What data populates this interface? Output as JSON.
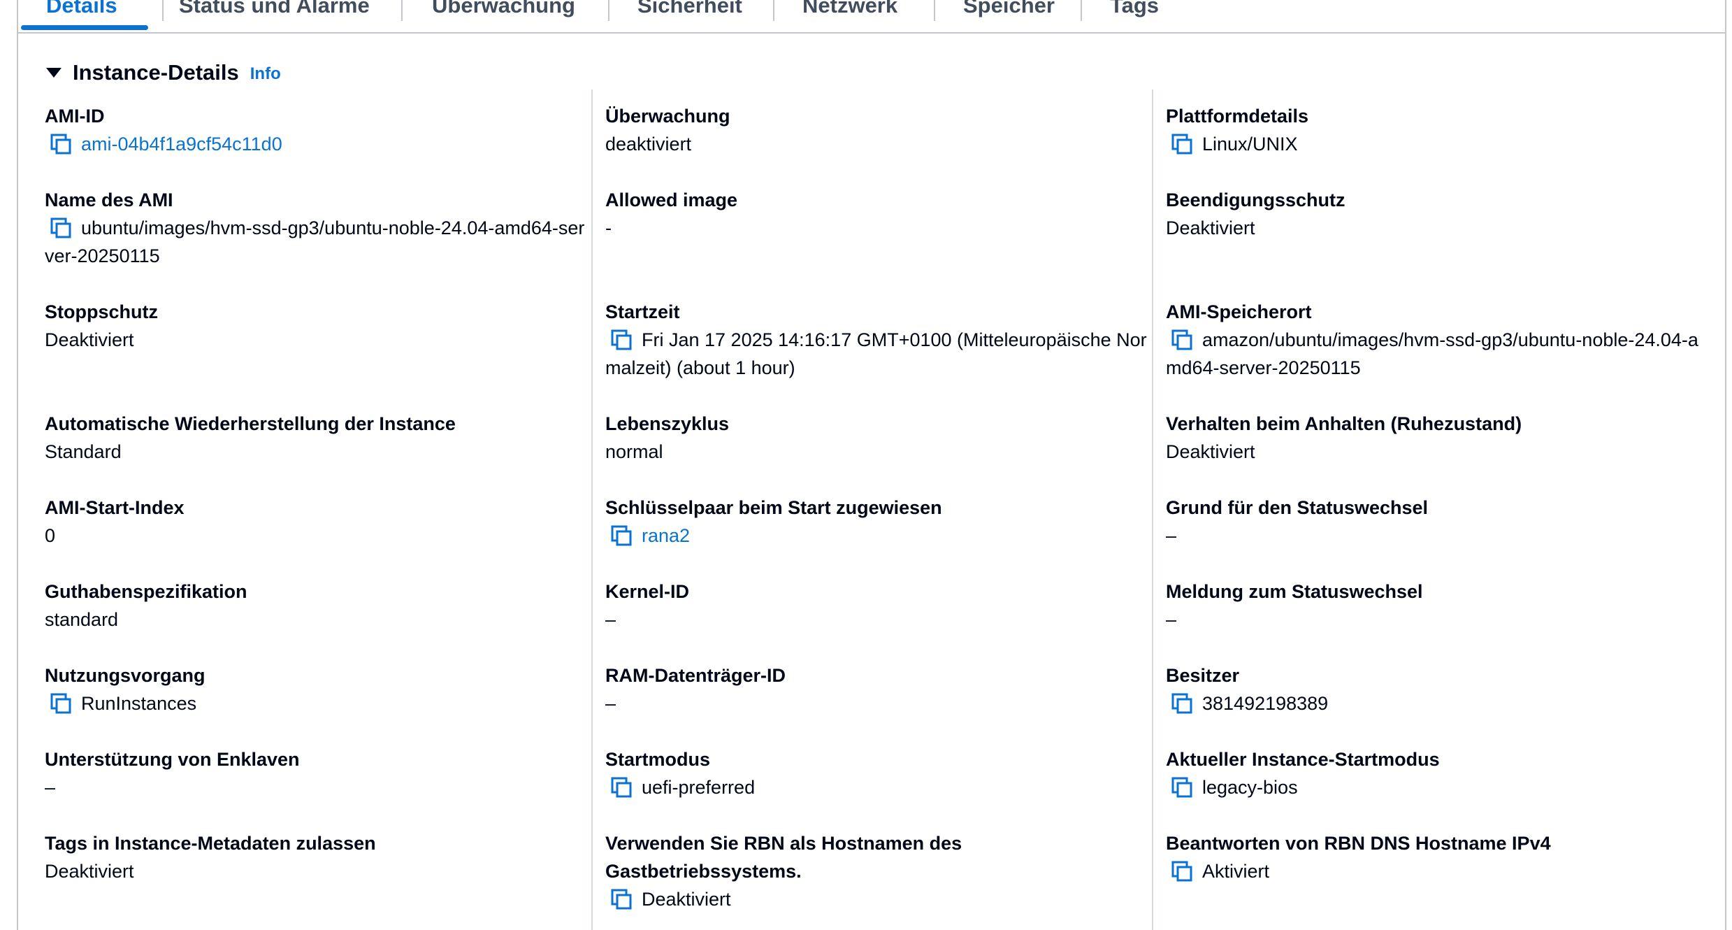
{
  "tabs": [
    {
      "label": "Details"
    },
    {
      "label": "Status und Alarme"
    },
    {
      "label": "Überwachung"
    },
    {
      "label": "Sicherheit"
    },
    {
      "label": "Netzwerk"
    },
    {
      "label": "Speicher"
    },
    {
      "label": "Tags"
    }
  ],
  "section": {
    "title": "Instance-Details",
    "info": "Info"
  },
  "col1": [
    {
      "label": "AMI-ID",
      "value": "ami-04b4f1a9cf54c11d0"
    },
    {
      "label": "Name des AMI",
      "value": "ubuntu/images/hvm-ssd-gp3/ubuntu-noble-24.04-amd64-server-20250115"
    },
    {
      "label": "Stoppschutz",
      "value": "Deaktiviert"
    },
    {
      "label": "Automatische Wiederherstellung der Instance",
      "value": "Standard"
    },
    {
      "label": "AMI-Start-Index",
      "value": "0"
    },
    {
      "label": "Guthabenspezifikation",
      "value": "standard"
    },
    {
      "label": "Nutzungsvorgang",
      "value": "RunInstances"
    },
    {
      "label": "Unterstützung von Enklaven",
      "value": "–"
    },
    {
      "label": "Tags in Instance-Metadaten zulassen",
      "value": "Deaktiviert"
    }
  ],
  "col2": [
    {
      "label": "Überwachung",
      "value": "deaktiviert"
    },
    {
      "label": "Allowed image",
      "value": "-"
    },
    {
      "label": "Startzeit",
      "value": "Fri Jan 17 2025 14:16:17 GMT+0100 (Mitteleuropäische Normalzeit) (about 1 hour)"
    },
    {
      "label": "Lebenszyklus",
      "value": "normal"
    },
    {
      "label": "Schlüsselpaar beim Start zugewiesen",
      "value": "rana2"
    },
    {
      "label": "Kernel-ID",
      "value": "–"
    },
    {
      "label": "RAM-Datenträger-ID",
      "value": "–"
    },
    {
      "label": "Startmodus",
      "value": "uefi-preferred"
    },
    {
      "label": "Verwenden Sie RBN als Hostnamen des Gastbetriebssystems.",
      "value": "Deaktiviert"
    }
  ],
  "col3": [
    {
      "label": "Plattformdetails",
      "value": "Linux/UNIX"
    },
    {
      "label": "Beendigungsschutz",
      "value": "Deaktiviert"
    },
    {
      "label": "AMI-Speicherort",
      "value": "amazon/ubuntu/images/hvm-ssd-gp3/ubuntu-noble-24.04-amd64-server-20250115"
    },
    {
      "label": "Verhalten beim Anhalten (Ruhezustand)",
      "value": "Deaktiviert"
    },
    {
      "label": "Grund für den Statuswechsel",
      "value": "–"
    },
    {
      "label": "Meldung zum Statuswechsel",
      "value": "–"
    },
    {
      "label": "Besitzer",
      "value": "381492198389"
    },
    {
      "label": "Aktueller Instance-Startmodus",
      "value": "legacy-bios"
    },
    {
      "label": "Beantworten von RBN DNS Hostname IPv4",
      "value": "Aktiviert"
    }
  ],
  "colors": {
    "link": "#0972d3",
    "text": "#000716",
    "border": "#c6c6cd"
  },
  "icons": {
    "copy": "copy-icon",
    "caret": "caret-down-icon"
  }
}
